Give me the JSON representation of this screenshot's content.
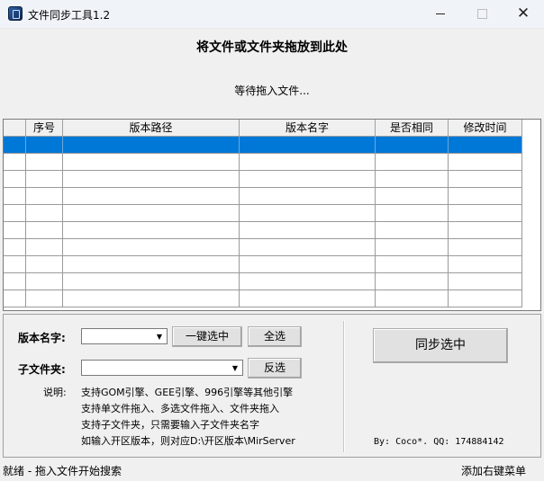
{
  "window": {
    "title": "文件同步工具1.2",
    "min_icon": "minimize-icon",
    "max_icon": "maximize-icon",
    "close_icon": "close-icon",
    "close_glyph": "✕"
  },
  "drop_zone": {
    "title": "将文件或文件夹拖放到此处",
    "status": "等待拖入文件..."
  },
  "table": {
    "columns": [
      "",
      "序号",
      "版本路径",
      "版本名字",
      "是否相同",
      "修改时间"
    ],
    "rows": [
      [
        "",
        "",
        "",
        "",
        "",
        ""
      ],
      [
        "",
        "",
        "",
        "",
        "",
        ""
      ],
      [
        "",
        "",
        "",
        "",
        "",
        ""
      ],
      [
        "",
        "",
        "",
        "",
        "",
        ""
      ],
      [
        "",
        "",
        "",
        "",
        "",
        ""
      ],
      [
        "",
        "",
        "",
        "",
        "",
        ""
      ],
      [
        "",
        "",
        "",
        "",
        "",
        ""
      ],
      [
        "",
        "",
        "",
        "",
        "",
        ""
      ],
      [
        "",
        "",
        "",
        "",
        "",
        ""
      ],
      [
        "",
        "",
        "",
        "",
        "",
        ""
      ]
    ],
    "selected_row": 0,
    "selection_color": "#0078d7"
  },
  "form": {
    "version_label": "版本名字:",
    "version_value": "",
    "subfolder_label": "子文件夹:",
    "subfolder_value": "",
    "one_click_label": "一键选中",
    "select_all_label": "全选",
    "invert_label": "反选",
    "sync_label": "同步选中",
    "note_label": "说明:",
    "notes": [
      "支持GOM引擎、GEE引擎、996引擎等其他引擎",
      "支持单文件拖入、多选文件拖入、文件夹拖入",
      "支持子文件夹，只需要输入子文件夹名字",
      "如输入开区版本，则对应D:\\开区版本\\MirServer"
    ],
    "credit": "By: Coco*.  QQ: 174884142"
  },
  "status": {
    "left": "就绪 - 拖入文件开始搜索",
    "right": "添加右键菜单"
  }
}
